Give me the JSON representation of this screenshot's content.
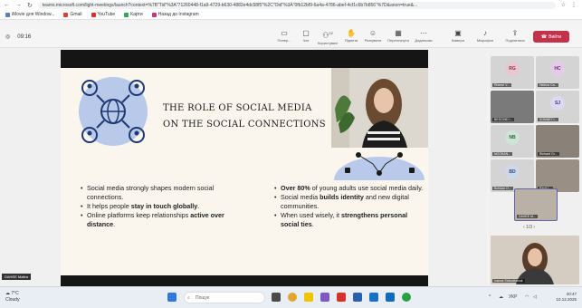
{
  "browser": {
    "url": "teams.microsoft.com/light-meetings/launch?context=%7B\"Tid\"%3A\"71260448-f1a9-4729-b630-4882e4dc58f5\"%2C\"Oid\"%3A\"0fb12bf9-6a4a-4786-abef-4cf1c6b7b856\"%7D&anon=true&...",
    "bookmarks": [
      "iMovie для Window...",
      "Gmail",
      "YouTube",
      "Карти",
      "Назад до Instagram"
    ]
  },
  "meeting": {
    "timer": "09:16",
    "participants_count": "22",
    "tools": [
      {
        "label": "Попер...",
        "icon": "back-icon"
      },
      {
        "label": "Чат",
        "icon": "chat-icon"
      },
      {
        "label": "Користувачі",
        "icon": "people-icon"
      },
      {
        "label": "Підняти",
        "icon": "hand-icon"
      },
      {
        "label": "Реагувати",
        "icon": "smile-icon"
      },
      {
        "label": "Переглянути",
        "icon": "view-icon"
      },
      {
        "label": "Додатково",
        "icon": "more-icon"
      },
      {
        "label": "Камера",
        "icon": "camera-icon"
      },
      {
        "label": "Мікрофон",
        "icon": "mic-icon"
      },
      {
        "label": "Поділитися",
        "icon": "share-icon"
      }
    ],
    "leave_label": "Вийти"
  },
  "slide": {
    "title_line1": "THE ROLE OF SOCIAL MEDIA",
    "title_line2": "ON THE SOCIAL CONNECTIONS",
    "left_bullets": [
      {
        "pre": "Social media strongly shapes modern social connections.",
        "bold": "",
        "post": ""
      },
      {
        "pre": "It helps people ",
        "bold": "stay in touch globally",
        "post": "."
      },
      {
        "pre": "Online platforms keep relationships ",
        "bold": "active over distance",
        "post": "."
      }
    ],
    "right_bullets": [
      {
        "pre": "",
        "bold": "Over 80%",
        "post": " of young adults use social media daily."
      },
      {
        "pre": "Social media ",
        "bold": "builds identity",
        "post": " and new digital communities."
      },
      {
        "pre": "When used wisely, it ",
        "bold": "strengthens personal social ties",
        "post": "."
      }
    ]
  },
  "presenter_tag": "DAHEE Matira",
  "gallery": {
    "tiles": [
      {
        "initials": "RG",
        "name": "Rhieee V...",
        "color": "#e7c8cf",
        "text": "#8a2a42"
      },
      {
        "initials": "HC",
        "name": "Helena Ca...",
        "color": "#e3cde6",
        "text": "#6e2a7a"
      },
      {
        "initials": "",
        "name": "BESCIND I...",
        "color": "#7a7a7a",
        "text": "#fff"
      },
      {
        "initials": "SJ",
        "name": "SONNET I...",
        "color": "#dcd9f0",
        "text": "#3b3a8a"
      },
      {
        "initials": "NB",
        "name": "NGOKAN...",
        "color": "#cfe3d6",
        "text": "#2a6a3e"
      },
      {
        "initials": "",
        "name": "Richard Gr...",
        "color": "#8a8278",
        "text": "#fff"
      },
      {
        "initials": "BD",
        "name": "Bohdan O...",
        "color": "#cdd8ea",
        "text": "#2b4a80"
      },
      {
        "initials": "",
        "name": "Racit I...",
        "color": "#9a8f84",
        "text": "#fff"
      },
      {
        "initials": "",
        "name": "DAHEE M...",
        "color": "#b9b0a6",
        "text": "#fff"
      }
    ],
    "pager": "1/3",
    "big_name": "Ivanna Slobodianiuk"
  },
  "taskbar": {
    "weather_temp": "7°C",
    "weather_desc": "Cloudy",
    "search": "Пошук",
    "lang": "УКР",
    "time": "20:47",
    "date": "10.12.2025"
  }
}
